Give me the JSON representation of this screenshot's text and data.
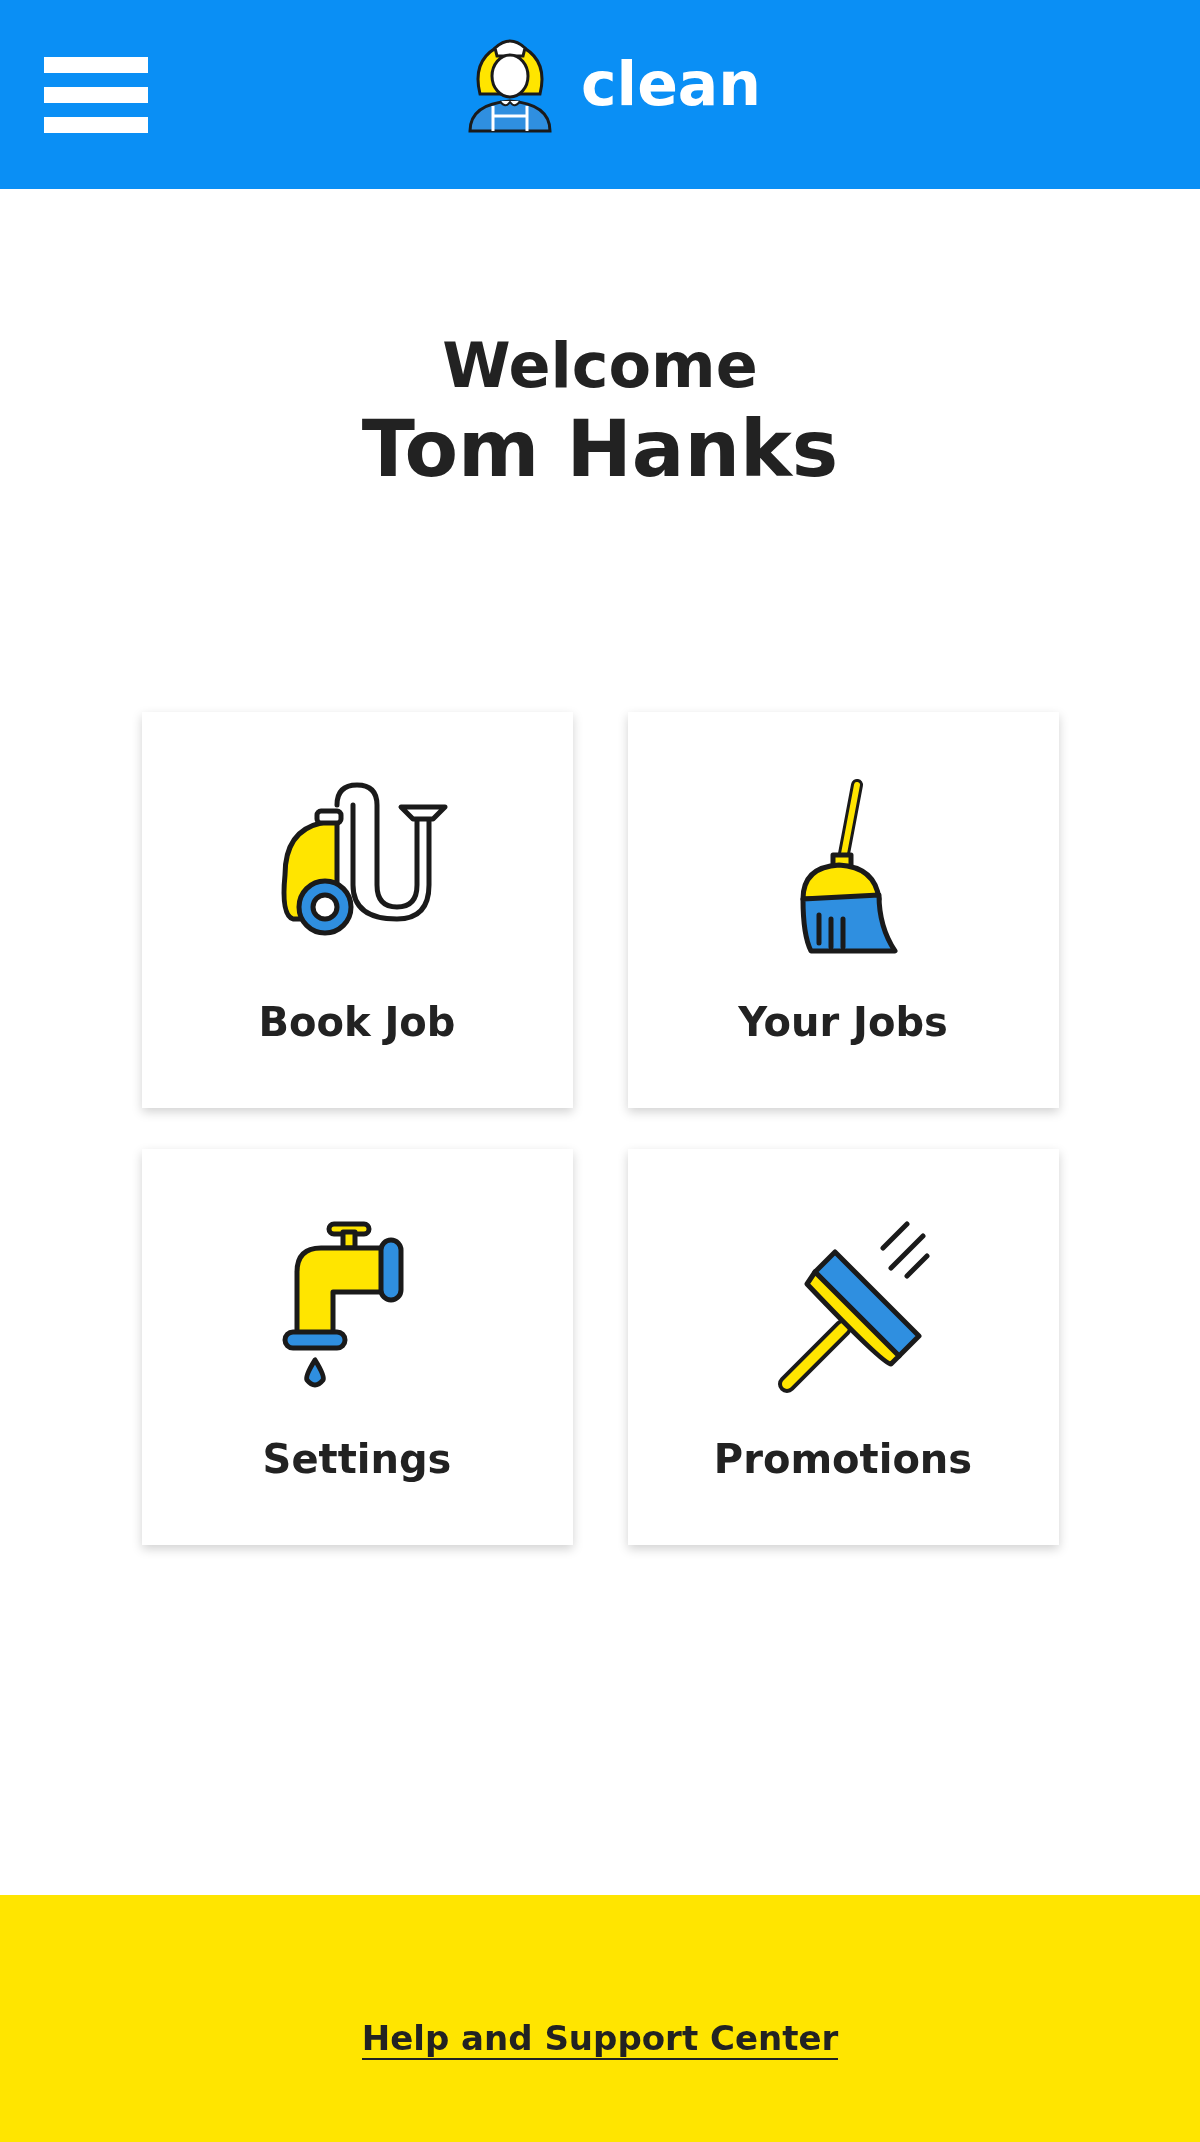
{
  "header": {
    "brand": "clean"
  },
  "welcome": {
    "greeting": "Welcome",
    "name": "Tom Hanks"
  },
  "tiles": [
    {
      "kind": "vacuum",
      "label": "Book Job"
    },
    {
      "kind": "broom",
      "label": "Your Jobs"
    },
    {
      "kind": "tap",
      "label": "Settings"
    },
    {
      "kind": "squeegee",
      "label": "Promotions"
    }
  ],
  "footer": {
    "link": "Help and Support Center"
  }
}
